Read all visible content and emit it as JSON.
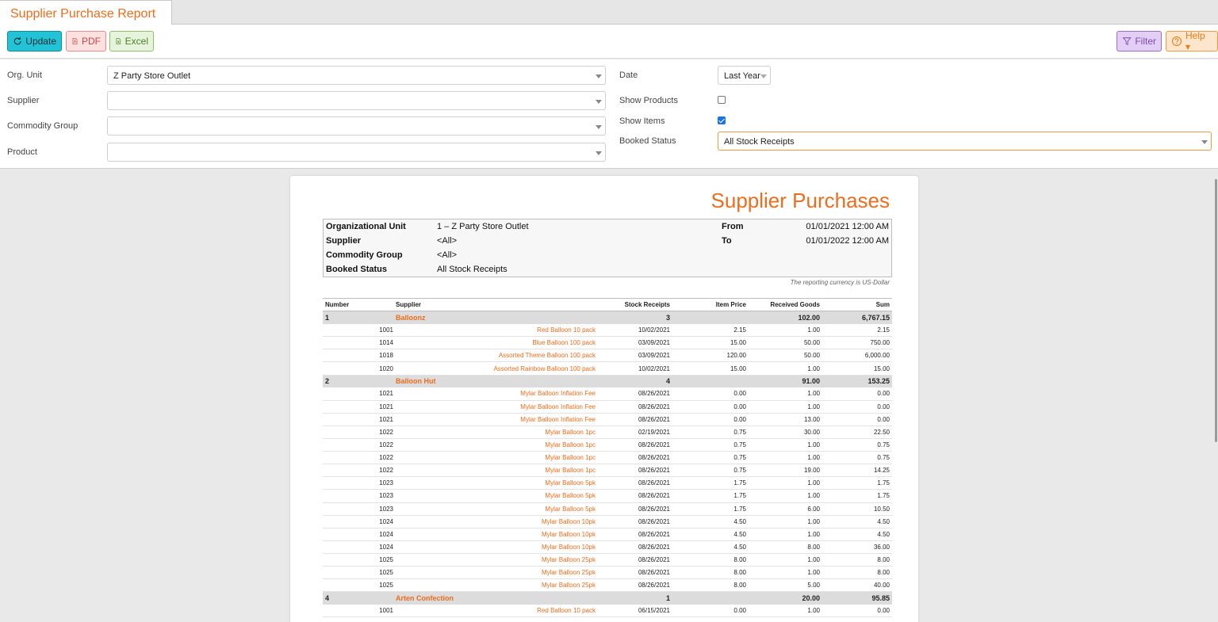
{
  "tab": {
    "title": "Supplier Purchase Report"
  },
  "toolbar": {
    "update_label": "Update",
    "pdf_label": "PDF",
    "excel_label": "Excel",
    "filter_label": "Filter",
    "help_label": "Help ▾"
  },
  "filters": {
    "org_unit": {
      "label": "Org. Unit",
      "value": "Z Party Store Outlet"
    },
    "supplier": {
      "label": "Supplier",
      "value": ""
    },
    "commodity_group": {
      "label": "Commodity Group",
      "value": ""
    },
    "product": {
      "label": "Product",
      "value": ""
    },
    "date": {
      "label": "Date",
      "value": "Last Year"
    },
    "show_products": {
      "label": "Show Products",
      "checked": false
    },
    "show_items": {
      "label": "Show Items",
      "checked": true
    },
    "booked_status": {
      "label": "Booked Status",
      "value": "All Stock Receipts"
    }
  },
  "report": {
    "title": "Supplier Purchases",
    "info": {
      "org_unit_label": "Organizational Unit",
      "org_unit_value": "1 – Z Party Store Outlet",
      "supplier_label": "Supplier",
      "supplier_value": "<All>",
      "commodity_label": "Commodity Group",
      "commodity_value": "<All>",
      "status_label": "Booked Status",
      "status_value": "All Stock Receipts",
      "from_label": "From",
      "from_value": "01/01/2021 12:00 AM",
      "to_label": "To",
      "to_value": "01/01/2022 12:00 AM"
    },
    "currency_note": "The reporting currency is US-Dollar",
    "columns": [
      "Number",
      "Supplier",
      "Stock Receipts",
      "Item Price",
      "Received Goods",
      "Sum"
    ],
    "groups": [
      {
        "number": "1",
        "supplier": "Balloonz",
        "receipts": "3",
        "received": "102.00",
        "sum": "6,767.15",
        "items": [
          [
            "1001",
            "Red Balloon 10 pack",
            "10/02/2021",
            "2.15",
            "1.00",
            "2.15"
          ],
          [
            "1014",
            "Blue Balloon 100 pack",
            "03/09/2021",
            "15.00",
            "50.00",
            "750.00"
          ],
          [
            "1018",
            "Assorted Theme Balloon 100 pack",
            "03/09/2021",
            "120.00",
            "50.00",
            "6,000.00"
          ],
          [
            "1020",
            "Assorted Rainbow Balloon 100 pack",
            "10/02/2021",
            "15.00",
            "1.00",
            "15.00"
          ]
        ]
      },
      {
        "number": "2",
        "supplier": "Balloon Hut",
        "receipts": "4",
        "received": "91.00",
        "sum": "153.25",
        "items": [
          [
            "1021",
            "Mylar Balloon Inflation Fee",
            "08/26/2021",
            "0.00",
            "1.00",
            "0.00"
          ],
          [
            "1021",
            "Mylar Balloon Inflation Fee",
            "08/26/2021",
            "0.00",
            "1.00",
            "0.00"
          ],
          [
            "1021",
            "Mylar Balloon Inflation Fee",
            "08/26/2021",
            "0.00",
            "13.00",
            "0.00"
          ],
          [
            "1022",
            "Mylar Balloon 1pc",
            "02/19/2021",
            "0.75",
            "30.00",
            "22.50"
          ],
          [
            "1022",
            "Mylar Balloon 1pc",
            "08/26/2021",
            "0.75",
            "1.00",
            "0.75"
          ],
          [
            "1022",
            "Mylar Balloon 1pc",
            "08/26/2021",
            "0.75",
            "1.00",
            "0.75"
          ],
          [
            "1022",
            "Mylar Balloon 1pc",
            "08/26/2021",
            "0.75",
            "19.00",
            "14.25"
          ],
          [
            "1023",
            "Mylar Balloon 5pk",
            "08/26/2021",
            "1.75",
            "1.00",
            "1.75"
          ],
          [
            "1023",
            "Mylar Balloon 5pk",
            "08/26/2021",
            "1.75",
            "1.00",
            "1.75"
          ],
          [
            "1023",
            "Mylar Balloon 5pk",
            "08/26/2021",
            "1.75",
            "6.00",
            "10.50"
          ],
          [
            "1024",
            "Mylar Balloon 10pk",
            "08/26/2021",
            "4.50",
            "1.00",
            "4.50"
          ],
          [
            "1024",
            "Mylar Balloon 10pk",
            "08/26/2021",
            "4.50",
            "1.00",
            "4.50"
          ],
          [
            "1024",
            "Mylar Balloon 10pk",
            "08/26/2021",
            "4.50",
            "8.00",
            "36.00"
          ],
          [
            "1025",
            "Mylar Balloon 25pk",
            "08/26/2021",
            "8.00",
            "1.00",
            "8.00"
          ],
          [
            "1025",
            "Mylar Balloon 25pk",
            "08/26/2021",
            "8.00",
            "1.00",
            "8.00"
          ],
          [
            "1025",
            "Mylar Balloon 25pk",
            "08/26/2021",
            "8.00",
            "5.00",
            "40.00"
          ]
        ]
      },
      {
        "number": "4",
        "supplier": "Arten Confection",
        "receipts": "1",
        "received": "20.00",
        "sum": "95.85",
        "items": [
          [
            "1001",
            "Red Balloon 10 pack",
            "06/15/2021",
            "0.00",
            "1.00",
            "0.00"
          ]
        ]
      }
    ]
  },
  "colors": {
    "accent": "#ee6d1d",
    "update": "#22c3d6",
    "pdf": "#d04545",
    "excel": "#4b7f2b",
    "filter": "#7b4ab3",
    "help": "#e87d17"
  }
}
